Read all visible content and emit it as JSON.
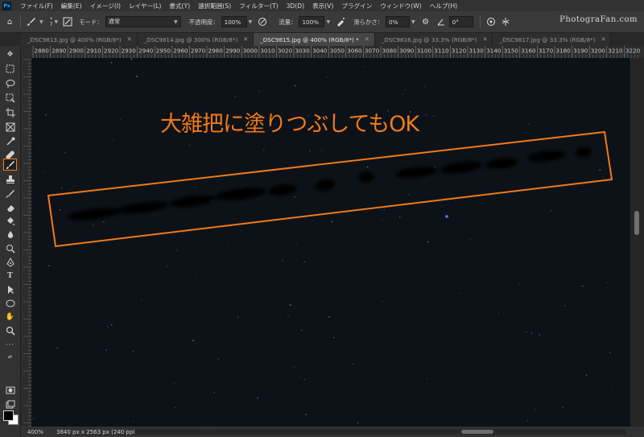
{
  "menubar": {
    "items": [
      "ファイル(F)",
      "編集(E)",
      "イメージ(I)",
      "レイヤー(L)",
      "書式(Y)",
      "選択範囲(S)",
      "フィルター(T)",
      "3D(D)",
      "表示(V)",
      "プラグイン",
      "ウィンドウ(W)",
      "ヘルプ(H)"
    ]
  },
  "options": {
    "brush_size": "7",
    "mode_label": "モード：",
    "mode_value": "通常",
    "opacity_label": "不透明度：",
    "opacity_value": "100%",
    "flow_label": "流量：",
    "flow_value": "100%",
    "smoothing_label": "滑らかさ：",
    "smoothing_value": "0%",
    "angle_value": "0°"
  },
  "watermark": "PhotograFan.com",
  "tabs": [
    {
      "label": "_DSC9813.jpg @ 400% (RGB/8*)",
      "active": false
    },
    {
      "label": "_DSC9814.jpg @ 300% (RGB/8*)",
      "active": false
    },
    {
      "label": "_DSC9815.jpg @ 400% (RGB/8*) *",
      "active": true
    },
    {
      "label": "_DSC9816.jpg @ 33.3% (RGB/8*)",
      "active": false
    },
    {
      "label": "_DSC9817.jpg @ 33.3% (RGB/8*)",
      "active": false
    }
  ],
  "ruler": {
    "top_labels": [
      "2880",
      "2890",
      "2900",
      "2910",
      "2920",
      "2930",
      "2940",
      "2950",
      "2960",
      "2970",
      "2980",
      "2990",
      "3000",
      "3010",
      "3020",
      "3030",
      "3040",
      "3050",
      "3060",
      "3070",
      "3080",
      "3090",
      "3100",
      "3110",
      "3120",
      "3130",
      "3140",
      "3150",
      "3160",
      "3170",
      "3180",
      "3190",
      "3200",
      "3210",
      "3220"
    ]
  },
  "annotation": {
    "text": "大雑把に塗りつぶしてもOK",
    "color": "#f07a18"
  },
  "status": {
    "zoom": "400%",
    "doc_info": "3840 px x 2563 px (240 ppi)"
  },
  "colors": {
    "accent": "#ff7a1a",
    "canvas": "#0d1218"
  }
}
